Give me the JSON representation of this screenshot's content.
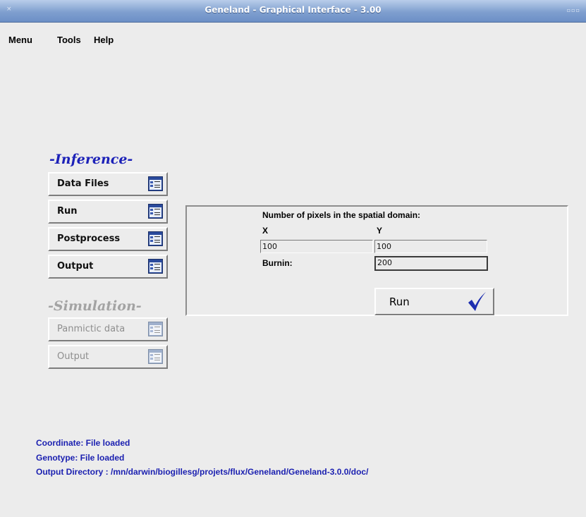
{
  "window": {
    "title": "Geneland - Graphical Interface - 3.00",
    "close_glyph": "×",
    "controls_glyph": "▫▫▫"
  },
  "menubar": {
    "items": [
      "Menu",
      "Tools",
      "Help"
    ]
  },
  "inference": {
    "heading": "-Inference-",
    "buttons": [
      {
        "label": "Data Files",
        "icon": "window-icon"
      },
      {
        "label": "Run",
        "icon": "window-icon"
      },
      {
        "label": "Postprocess",
        "icon": "window-icon"
      },
      {
        "label": "Output",
        "icon": "window-icon"
      }
    ]
  },
  "simulation": {
    "heading": "-Simulation-",
    "buttons": [
      {
        "label": "Panmictic data",
        "icon": "window-icon",
        "enabled": false
      },
      {
        "label": "Output",
        "icon": "window-icon",
        "enabled": false
      }
    ]
  },
  "run_panel": {
    "pixels_label": "Number of pixels in the spatial domain:",
    "x_label": "X",
    "y_label": "Y",
    "x_value": "100",
    "y_value": "100",
    "burnin_label": "Burnin:",
    "burnin_value": "200",
    "run_button": "Run",
    "run_icon": "checkmark-icon"
  },
  "status": {
    "coordinate": "Coordinate: File loaded",
    "genotype": "Genotype:  File loaded",
    "output_dir": "Output Directory : /mn/darwin/biogillesg/projets/flux/Geneland/Geneland-3.0.0/doc/"
  },
  "colors": {
    "accent": "#1c21b8",
    "titlebar": "#7f9fcf",
    "background": "#ececec"
  }
}
